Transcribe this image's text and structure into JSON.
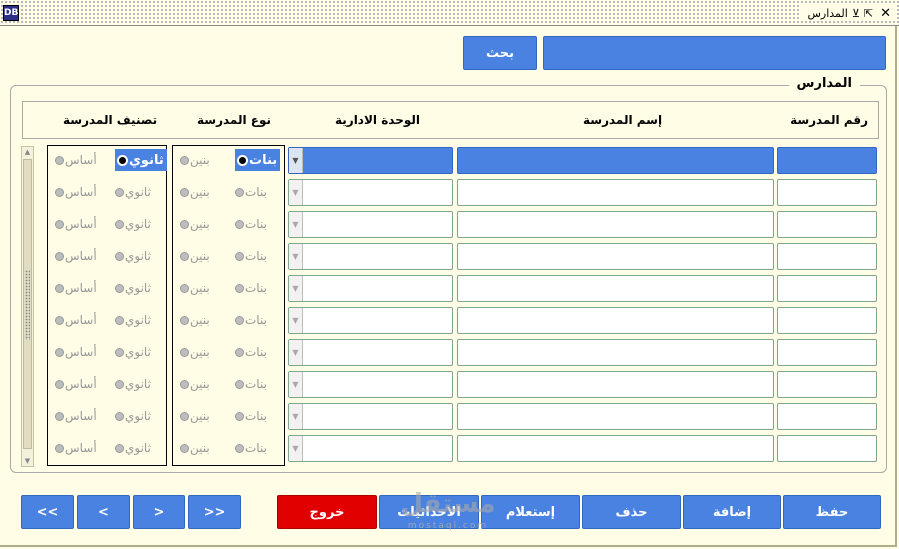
{
  "window": {
    "title": "المدارس",
    "app_icon_text": "DB",
    "title_glyph_left": "⇱",
    "title_glyph_right": "⊻",
    "close_glyph": "✕"
  },
  "search": {
    "button": "بحث"
  },
  "group": {
    "title": "المدارس"
  },
  "columns": {
    "number": "رقم المدرسة",
    "name": "إسم المدرسة",
    "unit": "الوحدة الادارية",
    "type": "نوع المدرسة",
    "classification": "تصنيف المدرسة"
  },
  "options": {
    "type": [
      "بنات",
      "بنين"
    ],
    "classification": [
      "ثانوي",
      "أساس"
    ]
  },
  "records": [
    {
      "number": "",
      "name": "",
      "unit": "",
      "type": "بنات",
      "classification": "ثانوي"
    },
    {
      "number": "",
      "name": "",
      "unit": "",
      "type": "",
      "classification": ""
    },
    {
      "number": "",
      "name": "",
      "unit": "",
      "type": "",
      "classification": ""
    },
    {
      "number": "",
      "name": "",
      "unit": "",
      "type": "",
      "classification": ""
    },
    {
      "number": "",
      "name": "",
      "unit": "",
      "type": "",
      "classification": ""
    },
    {
      "number": "",
      "name": "",
      "unit": "",
      "type": "",
      "classification": ""
    },
    {
      "number": "",
      "name": "",
      "unit": "",
      "type": "",
      "classification": ""
    },
    {
      "number": "",
      "name": "",
      "unit": "",
      "type": "",
      "classification": ""
    },
    {
      "number": "",
      "name": "",
      "unit": "",
      "type": "",
      "classification": ""
    },
    {
      "number": "",
      "name": "",
      "unit": "",
      "type": "",
      "classification": ""
    }
  ],
  "current_record": 1,
  "buttons": {
    "save": "حفظ",
    "add": "إضافة",
    "delete": "حذف",
    "query": "إستعلام",
    "coordinates": "الاحداثيات",
    "exit": "خروج",
    "first": ">>",
    "next": ">",
    "previous": "<",
    "last": "<<"
  },
  "watermark": {
    "logo": "مستقل",
    "site": "mostaql.com"
  },
  "colors": {
    "accent": "#4a82e2",
    "exit": "#e00000",
    "background": "#fffde6",
    "inactive_text": "#999999"
  }
}
